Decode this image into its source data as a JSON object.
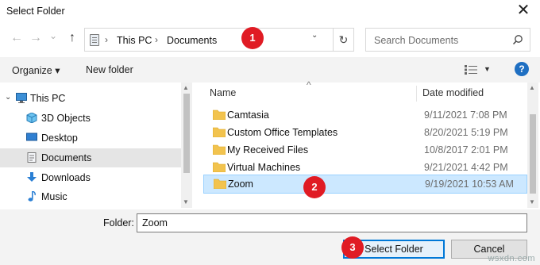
{
  "window": {
    "title": "Select Folder",
    "close_glyph": "✕"
  },
  "nav": {
    "back_glyph": "←",
    "forward_glyph": "→",
    "recent_glyph": "⌄",
    "up_glyph": "↑",
    "breadcrumbs": [
      "This PC",
      "Documents"
    ],
    "separator": "›",
    "dropdown_glyph": "⌄",
    "refresh_glyph": "↻",
    "search_placeholder": "Search Documents"
  },
  "annotations": {
    "badge1": "1",
    "badge2": "2",
    "badge3": "3",
    "badge_color": "#e01b24"
  },
  "toolbar": {
    "organize": "Organize ▾",
    "new_folder": "New folder",
    "view_dd": "▼",
    "help": "?"
  },
  "sidebar": {
    "items": [
      {
        "label": "This PC",
        "icon": "this-pc-icon"
      },
      {
        "label": "3D Objects",
        "icon": "3d-objects-icon"
      },
      {
        "label": "Desktop",
        "icon": "desktop-icon"
      },
      {
        "label": "Documents",
        "icon": "documents-icon"
      },
      {
        "label": "Downloads",
        "icon": "downloads-icon"
      },
      {
        "label": "Music",
        "icon": "music-icon"
      }
    ],
    "selected": "Documents"
  },
  "columns": {
    "name": "Name",
    "date": "Date modified"
  },
  "files": [
    {
      "name": "Camtasia",
      "date": "9/11/2021 7:08 PM"
    },
    {
      "name": "Custom Office Templates",
      "date": "8/20/2021 5:19 PM"
    },
    {
      "name": "My Received Files",
      "date": "10/8/2017 2:01 PM"
    },
    {
      "name": "Virtual Machines",
      "date": "9/21/2021 4:42 PM"
    },
    {
      "name": "Zoom",
      "date": "9/19/2021 10:53 AM"
    }
  ],
  "footer": {
    "folder_label": "Folder:",
    "folder_value": "Zoom",
    "select_button": "Select Folder",
    "cancel_button": "Cancel",
    "watermark": "wsxdn.com"
  },
  "colors": {
    "accent": "#0078d7",
    "selection": "#cce8ff",
    "folder": "#f2c34e"
  }
}
